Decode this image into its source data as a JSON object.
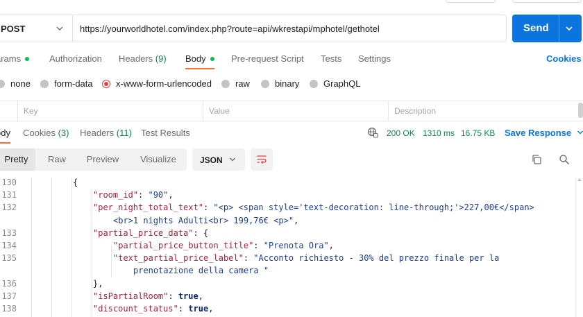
{
  "request": {
    "method": "POST",
    "url": "https://yourworldhotel.com/index.php?route=api/wkrestapi/mphotel/gethotel",
    "send_label": "Send"
  },
  "request_tabs": [
    {
      "label": "Params",
      "visible_text": "arams",
      "count": "",
      "dot": true,
      "active": false
    },
    {
      "label": "Authorization",
      "count": "",
      "dot": false,
      "active": false
    },
    {
      "label": "Headers",
      "count": "(9)",
      "dot": false,
      "active": false
    },
    {
      "label": "Body",
      "count": "",
      "dot": true,
      "active": true
    },
    {
      "label": "Pre-request Script",
      "count": "",
      "dot": false,
      "active": false
    },
    {
      "label": "Tests",
      "count": "",
      "dot": false,
      "active": false
    },
    {
      "label": "Settings",
      "count": "",
      "dot": false,
      "active": false
    }
  ],
  "cookies_link": "Cookies",
  "body_types": [
    {
      "label": "none",
      "selected": false
    },
    {
      "label": "form-data",
      "selected": false
    },
    {
      "label": "x-www-form-urlencoded",
      "selected": true
    },
    {
      "label": "raw",
      "selected": false
    },
    {
      "label": "binary",
      "selected": false
    },
    {
      "label": "GraphQL",
      "selected": false
    }
  ],
  "kv_table": {
    "key": "Key",
    "value": "Value",
    "description": "Description"
  },
  "response_tabs": [
    {
      "label": "Body",
      "visible_text": "ody",
      "count": "",
      "active": true
    },
    {
      "label": "Cookies",
      "count": "(3)",
      "active": false
    },
    {
      "label": "Headers",
      "count": "(11)",
      "active": false
    },
    {
      "label": "Test Results",
      "count": "",
      "active": false
    }
  ],
  "response_status": {
    "status": "200 OK",
    "time": "1310 ms",
    "size": "16.75 KB",
    "status_color": "#0c8a46"
  },
  "save_response": "Save Response",
  "view_modes": [
    {
      "label": "Pretty",
      "active": true
    },
    {
      "label": "Raw",
      "active": false
    },
    {
      "label": "Preview",
      "active": false
    },
    {
      "label": "Visualize",
      "active": false
    }
  ],
  "format": "JSON",
  "code_lines": [
    {
      "n": "130",
      "indent": 3,
      "parts": [
        {
          "t": "p",
          "v": "{"
        }
      ]
    },
    {
      "n": "131",
      "indent": 4,
      "parts": [
        {
          "t": "k",
          "v": "\"room_id\""
        },
        {
          "t": "p",
          "v": ": "
        },
        {
          "t": "s",
          "v": "\"90\""
        },
        {
          "t": "p",
          "v": ","
        }
      ]
    },
    {
      "n": "132",
      "indent": 4,
      "parts": [
        {
          "t": "k",
          "v": "\"per_night_total_text\""
        },
        {
          "t": "p",
          "v": ": "
        },
        {
          "t": "s",
          "v": "\"<p> <span style='text-decoration: line-through;'>227,00€</span>"
        }
      ]
    },
    {
      "n": "",
      "indent": 5,
      "parts": [
        {
          "t": "s",
          "v": "<br>1 nights Adulti<br> 199,76€ <p>\""
        },
        {
          "t": "p",
          "v": ","
        }
      ]
    },
    {
      "n": "133",
      "indent": 4,
      "parts": [
        {
          "t": "k",
          "v": "\"partial_price_data\""
        },
        {
          "t": "p",
          "v": ": {"
        }
      ]
    },
    {
      "n": "134",
      "indent": 5,
      "parts": [
        {
          "t": "k",
          "v": "\"partial_price_button_title\""
        },
        {
          "t": "p",
          "v": ": "
        },
        {
          "t": "s",
          "v": "\"Prenota Ora\""
        },
        {
          "t": "p",
          "v": ","
        }
      ]
    },
    {
      "n": "135",
      "indent": 5,
      "parts": [
        {
          "t": "k",
          "v": "\"text_partial_price_label\""
        },
        {
          "t": "p",
          "v": ": "
        },
        {
          "t": "s",
          "v": "\"Acconto richiesto - 30% del prezzo finale per la"
        }
      ]
    },
    {
      "n": "",
      "indent": 6,
      "parts": [
        {
          "t": "s",
          "v": "prenotazione della camera \""
        }
      ]
    },
    {
      "n": "136",
      "indent": 4,
      "parts": [
        {
          "t": "p",
          "v": "},"
        }
      ]
    },
    {
      "n": "137",
      "indent": 4,
      "parts": [
        {
          "t": "k",
          "v": "\"isPartialRoom\""
        },
        {
          "t": "p",
          "v": ": "
        },
        {
          "t": "b",
          "v": "true"
        },
        {
          "t": "p",
          "v": ","
        }
      ]
    },
    {
      "n": "138",
      "indent": 4,
      "parts": [
        {
          "t": "k",
          "v": "\"discount_status\""
        },
        {
          "t": "p",
          "v": ": "
        },
        {
          "t": "b",
          "v": "true"
        },
        {
          "t": "p",
          "v": ","
        }
      ]
    }
  ],
  "icons": {
    "method_dropdown": "chevron-down-icon",
    "send_dropdown": "chevron-down-icon",
    "network": "globe-network-icon",
    "wrap": "wrap-lines-icon",
    "copy": "copy-icon",
    "search": "search-icon"
  },
  "colors": {
    "accent": "#0b74de",
    "tab_indicator": "#ff6c37",
    "status_ok": "#0c8a46",
    "radio_selected": "#e0443e"
  }
}
